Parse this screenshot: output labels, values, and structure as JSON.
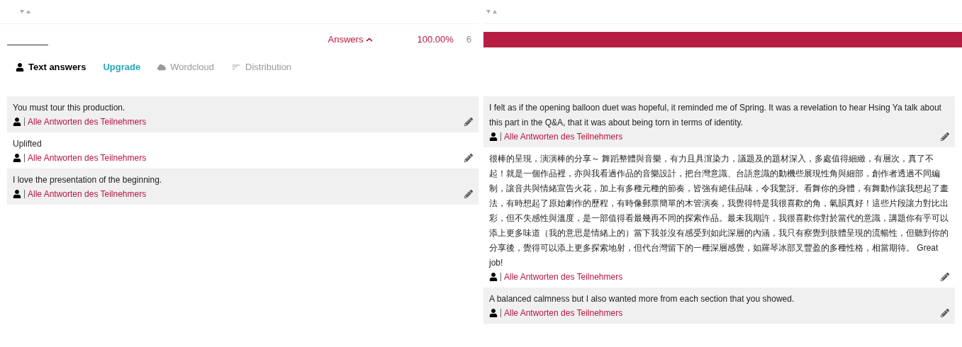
{
  "header": {
    "label": "Answers",
    "percent": "100.00%",
    "count": "6",
    "level": 1
  },
  "tabs": [
    {
      "kind": "tab",
      "label": "Text answers",
      "selected": true,
      "disabled": false
    },
    {
      "kind": "link",
      "label": "Upgrade",
      "selected": false,
      "disabled": false
    },
    {
      "kind": "cloud",
      "label": "Wordcloud",
      "selected": false,
      "disabled": true
    },
    {
      "kind": "bars",
      "label": "Distribution",
      "selected": false,
      "disabled": true
    }
  ],
  "columns": [
    [
      {
        "text": "You must tour this production.",
        "link": "Alle Antworten des Teilnehmers"
      },
      {
        "text": "Uplifted",
        "link": "Alle Antworten des Teilnehmers"
      },
      {
        "text": "I love the presentation of the beginning.",
        "link": "Alle Antworten des Teilnehmers"
      }
    ],
    [
      {
        "text": "I felt as if the opening balloon duet was hopeful, it reminded me of Spring. It was a revelation to hear Hsing Ya talk about this part in the Q&A, that it was about being torn in terms of identity.",
        "link": "Alle Antworten des Teilnehmers"
      },
      {
        "text": "很棒的呈現，演演棒的分享～ 舞蹈整體與音樂，有力且具渲染力，議題及的題材深入，多處值得細緻，有層次，真了不起！就是一個作品裡，亦與我看過作品的音樂設計，把台灣意識、台語意識的動機些展現性角與細部，創作者透過不同編制，讓音共與情緒宣告火花，加上有多種元種的節奏，皆強有絕佳品味，令我驚訝。看舞你的身體，有舞動作讓我想起了畫法，有時想起了原始劇作的歷程，有時像郵票簡單的木管演奏，我覺得特是我很喜歡的角，氣韻真好！這些片段讓力對比出彩，但不失感性與溫度，是一部值得看最幾再不同的探索作品。最未我期許，我很喜歡你對於當代的意識，講題你有乎可以添上更多味道（我的意思是情緒上的）當下我並沒有感受到如此深層的內涵，我只有察覺到肢體呈現的流暢性，但聽到你的分享後，覺得可以添上更多探索地射，但代台灣留下的一種深層感覺，如羅琴冰部叉豐盈的多種性格，相當期待。 Great job!",
        "link": "Alle Antworten des Teilnehmers"
      },
      {
        "text": "A balanced calmness but I also wanted more from each section that you showed.",
        "link": "Alle Antworten des Teilnehmers"
      }
    ]
  ]
}
